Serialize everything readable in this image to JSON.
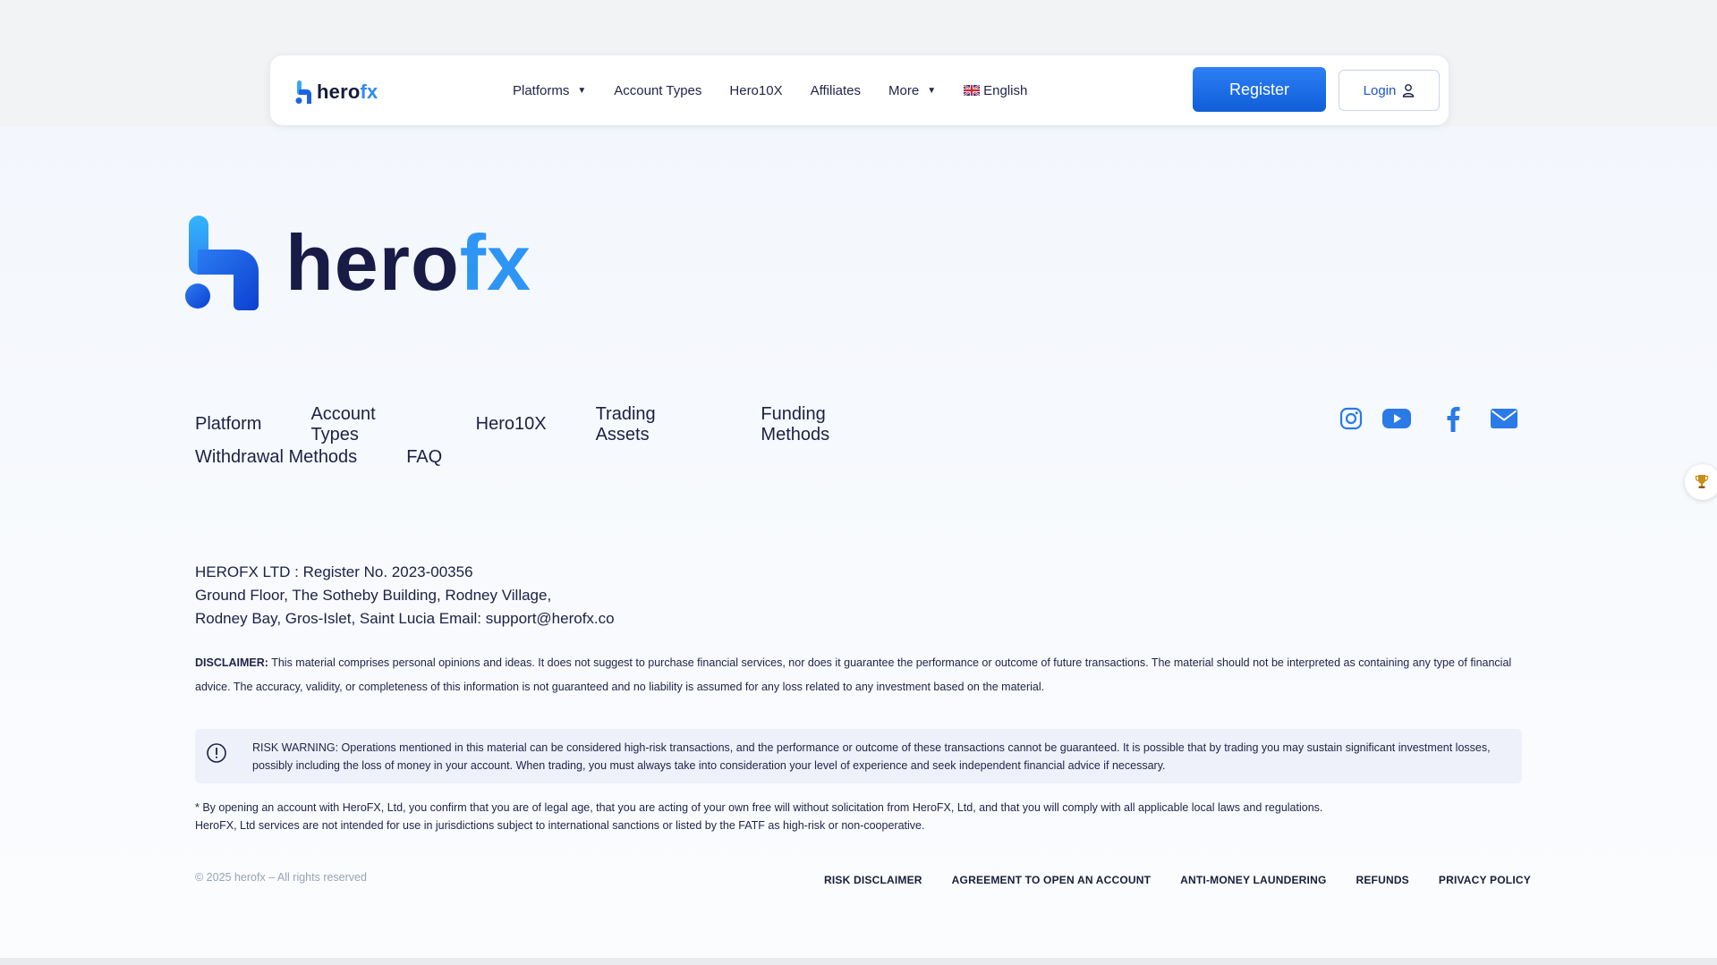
{
  "colors": {
    "accent": "#1565e0",
    "logo_blue": "#2f95f5",
    "logo_dark": "#181b45",
    "text": "#1d2045"
  },
  "header": {
    "logo_text_main": "hero",
    "logo_text_accent": "fx",
    "nav_items": [
      {
        "label": "Platforms",
        "dropdown": true
      },
      {
        "label": "Account Types",
        "dropdown": false
      },
      {
        "label": "Hero10X",
        "dropdown": false
      },
      {
        "label": "Affiliates",
        "dropdown": false
      },
      {
        "label": "More",
        "dropdown": true
      }
    ],
    "language": "English",
    "language_icon": "uk-flag-icon",
    "register_label": "Register",
    "login_label": "Login",
    "login_icon": "user-icon"
  },
  "brand": {
    "text_main": "hero",
    "text_accent": "fx"
  },
  "footer_nav": {
    "row1": [
      "Platform",
      "Account Types",
      "Hero10X",
      "Trading Assets",
      "Funding Methods"
    ],
    "row2": [
      "Withdrawal Methods",
      "FAQ"
    ]
  },
  "socials": [
    "instagram-icon",
    "youtube-icon",
    "facebook-icon",
    "mail-icon"
  ],
  "company": {
    "line1": "HEROFX LTD : Register No. 2023-00356",
    "line2": "Ground Floor, The Sotheby Building, Rodney Village,",
    "line3": "Rodney Bay, Gros-Islet, Saint Lucia Email: support@herofx.co"
  },
  "disclaimer": {
    "label": "DISCLAIMER:",
    "text": "This material comprises personal opinions and ideas. It does not suggest to purchase financial services, nor does it guarantee the performance or outcome of future transactions. The material should not be interpreted as containing any type of financial advice. The accuracy, validity, or completeness of this information is not guaranteed and no liability is assumed for any loss related to any investment based on the material."
  },
  "risk_warning": "RISK WARNING: Operations mentioned in this material can be considered high-risk transactions, and the performance or outcome of these transactions cannot be guaranteed. It is possible that by trading you may sustain significant investment losses, possibly including the loss of money in your account. When trading, you must always take into consideration your level of experience and seek independent financial advice if necessary.",
  "legal": {
    "line1": "* By opening an account with HeroFX, Ltd, you confirm that you are of legal age, that you are acting of your own free will without solicitation from HeroFX, Ltd, and that you will comply with all applicable local laws and regulations.",
    "line2": "HeroFX, Ltd services are not intended for use in jurisdictions subject to international sanctions or listed by the FATF as high-risk or non-cooperative."
  },
  "copyright": "© 2025 herofx – All rights reserved",
  "policy_links": [
    "RISK DISCLAIMER",
    "AGREEMENT TO OPEN AN ACCOUNT",
    "ANTI-MONEY LAUNDERING",
    "REFUNDS",
    "PRIVACY POLICY"
  ]
}
